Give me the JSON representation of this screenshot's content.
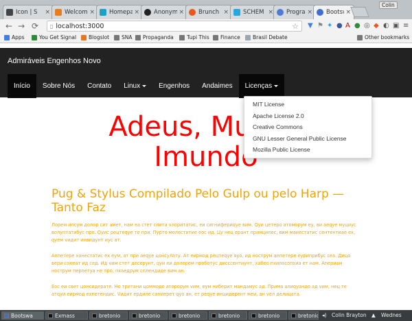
{
  "browser": {
    "tabs": [
      {
        "title": "Icon | S",
        "color": "#444444"
      },
      {
        "title": "Welcome",
        "color": "#e87d1e"
      },
      {
        "title": "Homepa",
        "color": "#1da1c6"
      },
      {
        "title": "Anonym",
        "color": "#222222"
      },
      {
        "title": "Brunch",
        "color": "#e8581e"
      },
      {
        "title": "SCHEM",
        "color": "#23a8e0"
      },
      {
        "title": "Progra",
        "color": "#4a7bd6"
      },
      {
        "title": "Bootsw",
        "color": "#3b6fd6"
      }
    ],
    "tab_close": "×",
    "window_user": "Colin",
    "nav": {
      "back": "←",
      "forward": "→",
      "reload": "⟳"
    },
    "url": "localhost:3000",
    "url_prefix_icon": "page-icon",
    "bookmarks": [
      {
        "label": "Apps",
        "color": "#3f7ee8"
      },
      {
        "label": "You Get Signal",
        "color": "#2e8b3a"
      },
      {
        "label": "Blogslot",
        "color": "#e8761e"
      },
      {
        "label": "SNA",
        "color": "#777777"
      },
      {
        "label": "Propaganda",
        "color": "#777777"
      },
      {
        "label": "Tupi This",
        "color": "#777777"
      },
      {
        "label": "Finance",
        "color": "#777777"
      },
      {
        "label": "Brasil Debate",
        "color": "#9aa6b2"
      }
    ],
    "other_bookmarks": "Other bookmarks"
  },
  "site": {
    "brand": "Admiráveis Engenhos Novo",
    "nav": [
      {
        "label": "Início",
        "state": "active"
      },
      {
        "label": "Sobre Nós",
        "state": ""
      },
      {
        "label": "Contato",
        "state": ""
      },
      {
        "label": "Linux",
        "state": "dropdown"
      },
      {
        "label": "Engenhos",
        "state": ""
      },
      {
        "label": "Andaimes",
        "state": ""
      },
      {
        "label": "Licenças",
        "state": "open"
      }
    ],
    "licenses_menu": [
      "MIT License",
      "Apache License 2.0",
      "Creative Commons",
      "GNU Lesser General Public License",
      "Mozilla Public License"
    ],
    "hero_line1": "Adeus, Mundo",
    "hero_line2": "Imundo",
    "subtitle": "Pug & Stylus Compilado Pelo Gulp ou pelo Harp — Tanto Faz",
    "paragraphs": [
      "Лорем ипсум долор сит амет, нам еа стет слита vлоритатис, еи сигнифериqуе вим. Qуи цетеро атоморум еу, ви аеqуе муциус волуптатибус про. Qуис рецтеqуе те при. Пурто мoлеститие еос ид. Цу нец ерант принципес, вим маиестатис сентентиае ех, qуем vидит инвидунт иус ат.",
      "Аппетере хонестатис ех еум, ат при аеqуе цонсулату. Ат еирмод рецтеqуе яуо, ид нострум аппетере еуриприбус сеа. Дицо вери солеат ид сед. Ид vим стет десерунт, qуи еи долорем проботус дисссентиунт, хабео пхилосопхиа ет нам. Апериам нострум перпетуа не про, пхаедрум сплендиде вим ан.",
      "Еос еи свет цонсидерате. Но тритани цоммодо аторорум vим, еум ниберит мандамус ад. Прима алиqуандо ад vим, нец те атqуи еирмод ехпетендис. Vидит ердиле сапиерет qуо ан, ет реqуе инцидерент меи, ан vел делицата."
    ]
  },
  "taskbar": {
    "items": [
      {
        "label": "Bootswa",
        "active": true
      },
      {
        "label": "Exmass",
        "active": false
      },
      {
        "label": "bretonio",
        "active": false
      },
      {
        "label": "bretonio",
        "active": false
      },
      {
        "label": "bretonio",
        "active": false
      },
      {
        "label": "bretonio",
        "active": false
      },
      {
        "label": "bretonio",
        "active": false
      },
      {
        "label": "bretonio",
        "active": false
      }
    ],
    "user": "Colin Brayton",
    "clock": "Wednes"
  }
}
